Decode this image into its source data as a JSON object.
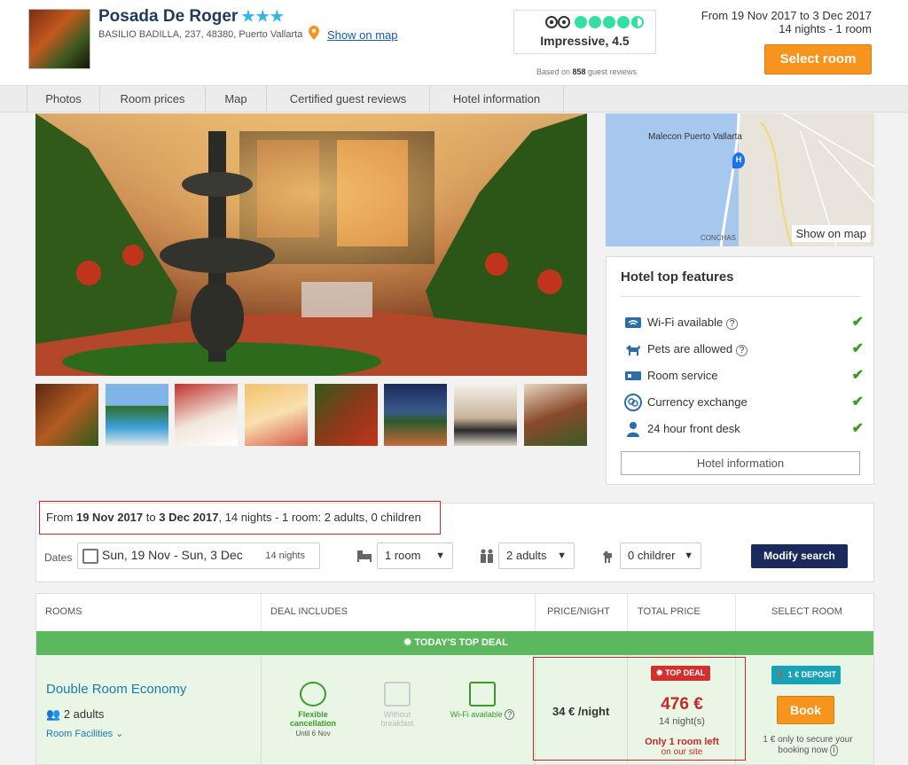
{
  "header": {
    "hotel_name": "Posada De Roger",
    "stars": "★★★",
    "address": "BASILIO BADILLA, 237, 48380, Puerto Vallarta",
    "show_on_map": "Show on map",
    "rating_text": "Impressive, 4.5",
    "rating_value": 4.5,
    "reviews_prefix": "Based on",
    "reviews_count": "858",
    "reviews_suffix": "guest reviews",
    "dates_line": "From 19 Nov 2017 to 3 Dec 2017",
    "nights_line": "14 nights - 1 room",
    "select_room": "Select room"
  },
  "tabs": [
    "Photos",
    "Room prices",
    "Map",
    "Certified guest reviews",
    "Hotel information"
  ],
  "map": {
    "label_malecon": "Malecon Puerto Vallarta",
    "label_conchas": "CONCHAS",
    "show_on_map": "Show on map"
  },
  "features": {
    "title": "Hotel top features",
    "items": [
      {
        "label": "Wi-Fi available",
        "icon": "wifi-icon",
        "info": "?"
      },
      {
        "label": "Pets are allowed",
        "icon": "pet-icon",
        "info": "?"
      },
      {
        "label": "Room service",
        "icon": "room-service-icon"
      },
      {
        "label": "Currency exchange",
        "icon": "currency-icon"
      },
      {
        "label": "24 hour front desk",
        "icon": "front-desk-icon"
      }
    ],
    "hotel_info_button": "Hotel information"
  },
  "search": {
    "summary_prefix": "From",
    "summary_start": "19 Nov 2017",
    "summary_to": "to",
    "summary_end": "3 Dec 2017",
    "summary_rest": ", 14 nights - 1 room: 2 adults, 0 children",
    "dates_label": "Dates",
    "dates_value": "Sun, 19 Nov - Sun, 3 Dec",
    "nights_value": "14 nights",
    "rooms_value": "1 room",
    "adults_value": "2 adults",
    "children_value": "0 childrer",
    "modify": "Modify search"
  },
  "table": {
    "headers": [
      "ROOMS",
      "DEAL INCLUDES",
      "PRICE/NIGHT",
      "TOTAL PRICE",
      "SELECT ROOM"
    ],
    "deal_banner": "TODAY'S TOP DEAL",
    "room_name": "Double Room Economy",
    "adults": "2 adults",
    "room_facilities": "Room Facilities",
    "deal1_title": "Flexible",
    "deal1_title2": "cancellation",
    "deal1_sub": "Until 6 Nov",
    "deal2_title": "Without",
    "deal2_title2": "breakfast",
    "deal3_title": "Wi-Fi available",
    "price_night": "34 € /night",
    "top_deal": "TOP DEAL",
    "total_price": "476 €",
    "total_nights": "14 night(s)",
    "only_left": "Only 1 room left",
    "on_our_site": "on our site",
    "deposit": "1 € DEPOSIT",
    "book": "Book",
    "secure1": "1 € only to secure your",
    "secure2": "booking now"
  }
}
